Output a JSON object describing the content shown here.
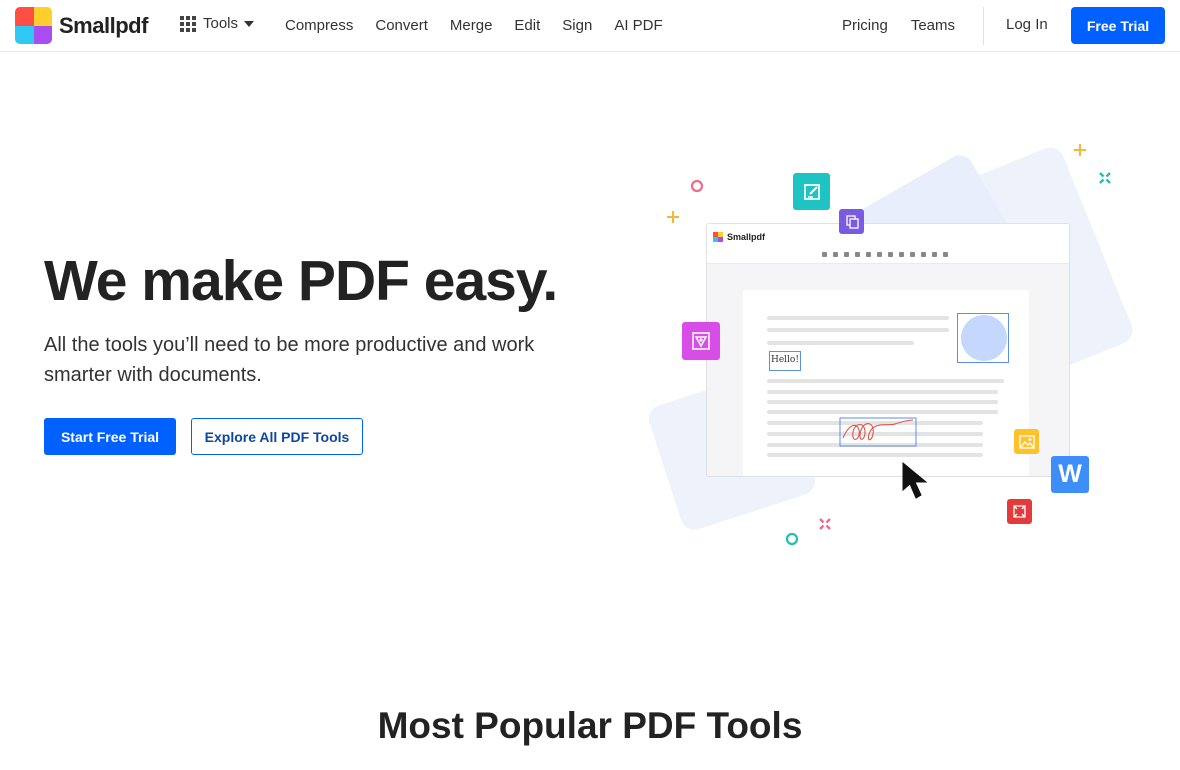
{
  "nav": {
    "brand": "Smallpdf",
    "tools_label": "Tools",
    "links": [
      "Compress",
      "Convert",
      "Merge",
      "Edit",
      "Sign",
      "AI PDF"
    ],
    "right_links": [
      "Pricing",
      "Teams"
    ],
    "login": "Log In",
    "cta": "Free Trial"
  },
  "hero": {
    "title": "We make PDF easy.",
    "subtitle": "All the tools you’ll need to be more productive and work smarter with documents.",
    "primary_cta": "Start Free Trial",
    "secondary_cta": "Explore All PDF Tools"
  },
  "illustration": {
    "app_name": "Smallpdf",
    "hello_text": "Hello!",
    "word_icon_letter": "W"
  },
  "popular": {
    "title": "Most Popular PDF Tools"
  },
  "colors": {
    "primary": "#0061fe",
    "text": "#222222"
  }
}
